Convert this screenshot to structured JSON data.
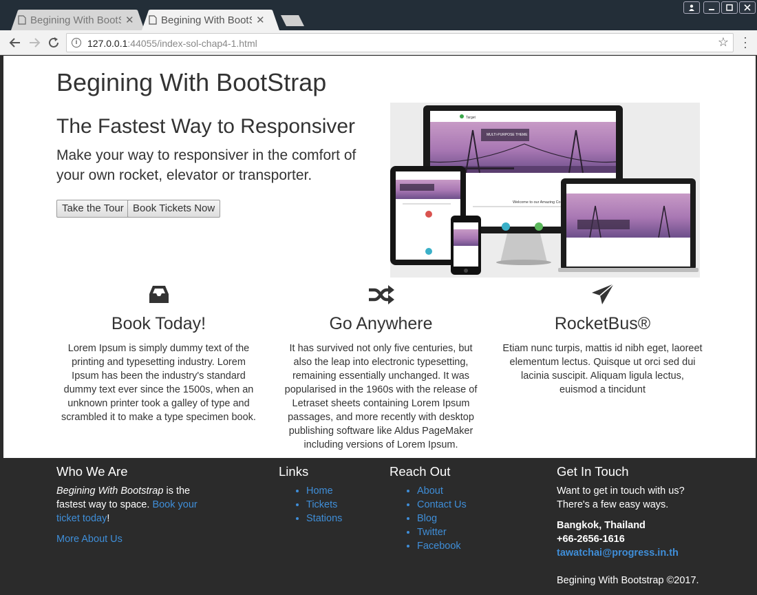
{
  "browser": {
    "tabs": [
      {
        "title": "Begining With BootStrap"
      },
      {
        "title": "Begining With BootStrap"
      }
    ],
    "url_host": "127.0.0.1",
    "url_rest": ":44055/index-sol-chap4-1.html"
  },
  "header": {
    "site_title": "Begining With BootStrap"
  },
  "hero": {
    "heading": "The Fastest Way to Responsiver",
    "lead": "Make your way to responsiver in the comfort of your own rocket, elevator or transporter.",
    "tour_button": "Take the Tour",
    "book_button": "Book Tickets Now"
  },
  "mockup": {
    "brand": "Target",
    "banner": "MULTI-PURPOSE THEME",
    "welcome": "Welcome to our Amazing Company"
  },
  "features": [
    {
      "icon": "inbox-icon",
      "title": "Book Today!",
      "text": "Lorem Ipsum is simply dummy text of the printing and typesetting industry. Lorem Ipsum has been the industry's standard dummy text ever since the 1500s, when an unknown printer took a galley of type and scrambled it to make a type specimen book."
    },
    {
      "icon": "shuffle-icon",
      "title": "Go Anywhere",
      "text": "It has survived not only five centuries, but also the leap into electronic typesetting, remaining essentially unchanged. It was popularised in the 1960s with the release of Letraset sheets containing Lorem Ipsum passages, and more recently with desktop publishing software like Aldus PageMaker including versions of Lorem Ipsum."
    },
    {
      "icon": "send-icon",
      "title": "RocketBus®",
      "text": "Etiam nunc turpis, mattis id nibh eget, laoreet elementum lectus. Quisque ut orci sed dui lacinia suscipit. Aliquam ligula lectus, euismod a tincidunt"
    }
  ],
  "footer": {
    "who": {
      "heading": "Who We Are",
      "brand": "Begining With Bootstrap",
      "text": " is the fastest way to space. ",
      "link": "Book your ticket today",
      "after": "!",
      "more": "More About Us"
    },
    "links": {
      "heading": "Links",
      "items": [
        "Home",
        "Tickets",
        "Stations"
      ]
    },
    "reach": {
      "heading": "Reach Out",
      "items": [
        "About",
        "Contact Us",
        "Blog",
        "Twitter",
        "Facebook"
      ]
    },
    "touch": {
      "heading": "Get In Touch",
      "text": "Want to get in touch with us? There's a few easy ways.",
      "city": "Bangkok, Thailand",
      "phone": "+66-2656-1616",
      "email": "tawatchai@progress.in.th",
      "copyright": "Begining With Bootstrap ©2017."
    }
  },
  "colors": {
    "link": "#3f8ed8",
    "footer_bg": "#2b2b2b",
    "chrome_bg": "#232e38"
  }
}
